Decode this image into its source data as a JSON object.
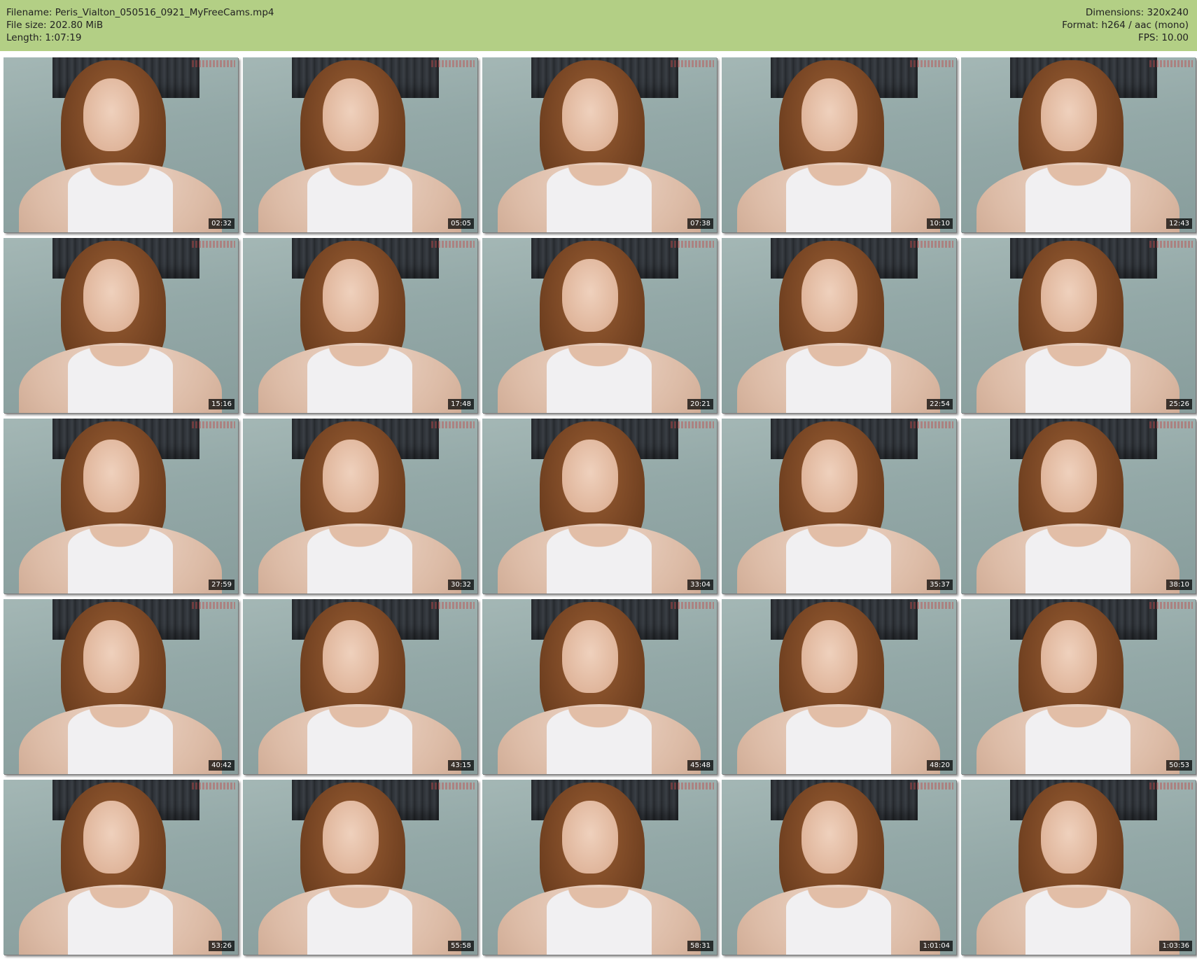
{
  "header": {
    "filename": "Filename: Peris_Vialton_050516_0921_MyFreeCams.mp4",
    "filesize": "File size: 202.80 MiB",
    "length": "Length: 1:07:19",
    "dimensions": "Dimensions: 320x240",
    "format": "Format: h264 / aac (mono)",
    "fps": "FPS: 10.00"
  },
  "thumbnails": [
    {
      "timestamp": "02:32"
    },
    {
      "timestamp": "05:05"
    },
    {
      "timestamp": "07:38"
    },
    {
      "timestamp": "10:10"
    },
    {
      "timestamp": "12:43"
    },
    {
      "timestamp": "15:16"
    },
    {
      "timestamp": "17:48"
    },
    {
      "timestamp": "20:21"
    },
    {
      "timestamp": "22:54"
    },
    {
      "timestamp": "25:26"
    },
    {
      "timestamp": "27:59"
    },
    {
      "timestamp": "30:32"
    },
    {
      "timestamp": "33:04"
    },
    {
      "timestamp": "35:37"
    },
    {
      "timestamp": "38:10"
    },
    {
      "timestamp": "40:42"
    },
    {
      "timestamp": "43:15"
    },
    {
      "timestamp": "45:48"
    },
    {
      "timestamp": "48:20"
    },
    {
      "timestamp": "50:53"
    },
    {
      "timestamp": "53:26"
    },
    {
      "timestamp": "55:58"
    },
    {
      "timestamp": "58:31"
    },
    {
      "timestamp": "1:01:04"
    },
    {
      "timestamp": "1:03:36"
    }
  ],
  "colors": {
    "header_bg": "#b3cf85",
    "timestamp_bg": "#000000"
  }
}
